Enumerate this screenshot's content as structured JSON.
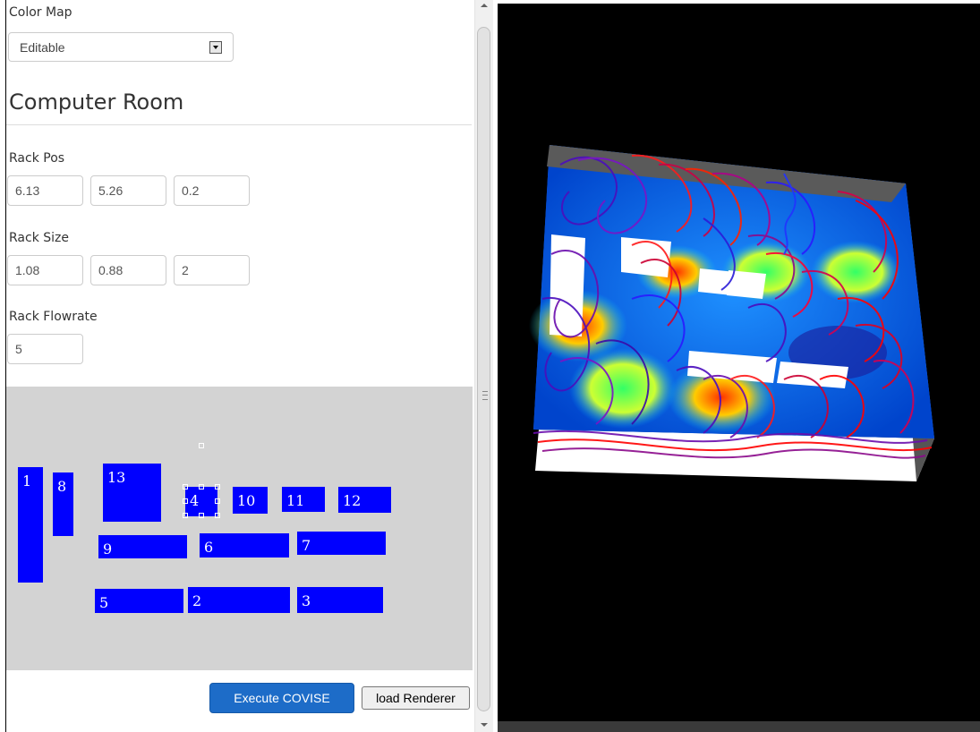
{
  "colormap": {
    "label": "Color Map",
    "selected": "Editable"
  },
  "section": {
    "title": "Computer Room"
  },
  "rack_pos": {
    "label": "Rack Pos",
    "values": [
      "6.13",
      "5.26",
      "0.2"
    ]
  },
  "rack_size": {
    "label": "Rack Size",
    "values": [
      "1.08",
      "0.88",
      "2"
    ]
  },
  "rack_flowrate": {
    "label": "Rack Flowrate",
    "value": "5"
  },
  "room_layout": {
    "background_color": "#d3d3d3",
    "rack_color": "#0000ff",
    "selected_rack": "4",
    "racks": [
      "1",
      "8",
      "13",
      "4",
      "10",
      "11",
      "12",
      "9",
      "6",
      "7",
      "5",
      "2",
      "3"
    ]
  },
  "actions": {
    "execute_label": "Execute COVISE",
    "load_label": "load Renderer"
  },
  "renderer": {
    "background_color": "#000000",
    "description_colors": [
      "#0000c8",
      "#00c8ff",
      "#ffff00",
      "#ff0000",
      "#6a0dad"
    ]
  }
}
